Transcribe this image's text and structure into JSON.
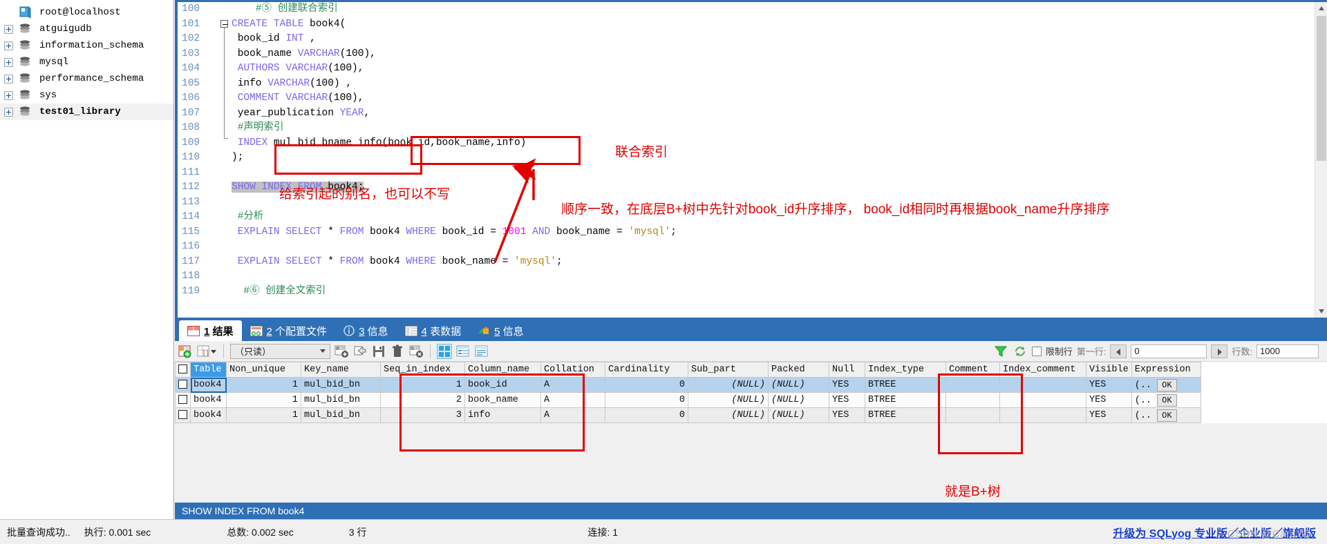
{
  "tree": {
    "root": {
      "label": "root@localhost",
      "icon": "server-icon"
    },
    "items": [
      {
        "label": "atguigudb",
        "icon": "database-icon"
      },
      {
        "label": "information_schema",
        "icon": "database-icon"
      },
      {
        "label": "mysql",
        "icon": "database-icon"
      },
      {
        "label": "performance_schema",
        "icon": "database-icon"
      },
      {
        "label": "sys",
        "icon": "database-icon"
      },
      {
        "label": "test01_library",
        "icon": "database-icon"
      }
    ]
  },
  "editor": {
    "first_line": 100,
    "lines": [
      {
        "n": "100",
        "segs": [
          {
            "t": "    #⑤ 创建联合索引",
            "c": "cmt"
          }
        ]
      },
      {
        "n": "101",
        "segs": [
          {
            "t": "CREATE TABLE ",
            "c": "kw"
          },
          {
            "t": "book4(",
            "c": ""
          }
        ]
      },
      {
        "n": "102",
        "segs": [
          {
            "t": " book_id ",
            "c": ""
          },
          {
            "t": "INT",
            "c": "kw"
          },
          {
            "t": " ,",
            "c": ""
          }
        ]
      },
      {
        "n": "103",
        "segs": [
          {
            "t": " book_name ",
            "c": ""
          },
          {
            "t": "VARCHAR",
            "c": "kw"
          },
          {
            "t": "(100),",
            "c": ""
          }
        ]
      },
      {
        "n": "104",
        "segs": [
          {
            "t": " ",
            "c": ""
          },
          {
            "t": "AUTHORS VARCHAR",
            "c": "kw"
          },
          {
            "t": "(100),",
            "c": ""
          }
        ]
      },
      {
        "n": "105",
        "segs": [
          {
            "t": " info ",
            "c": ""
          },
          {
            "t": "VARCHAR",
            "c": "kw"
          },
          {
            "t": "(100) ,",
            "c": ""
          }
        ]
      },
      {
        "n": "106",
        "segs": [
          {
            "t": " ",
            "c": ""
          },
          {
            "t": "COMMENT VARCHAR",
            "c": "kw"
          },
          {
            "t": "(100),",
            "c": ""
          }
        ]
      },
      {
        "n": "107",
        "segs": [
          {
            "t": " year_publication ",
            "c": ""
          },
          {
            "t": "YEAR",
            "c": "kw"
          },
          {
            "t": ",",
            "c": ""
          }
        ]
      },
      {
        "n": "108",
        "segs": [
          {
            "t": " #声明索引",
            "c": "cmt"
          }
        ]
      },
      {
        "n": "109",
        "segs": [
          {
            "t": " ",
            "c": ""
          },
          {
            "t": "INDEX",
            "c": "kw"
          },
          {
            "t": " mul_bid_bname_info(book_id,book_name,info)",
            "c": ""
          }
        ]
      },
      {
        "n": "110",
        "segs": [
          {
            "t": ");",
            "c": ""
          }
        ]
      },
      {
        "n": "111",
        "segs": [
          {
            "t": "",
            "c": ""
          }
        ]
      },
      {
        "n": "112",
        "segs": [
          {
            "t": "SHOW INDEX FROM ",
            "c": "kw sel"
          },
          {
            "t": "book4;",
            "c": "sel"
          }
        ]
      },
      {
        "n": "113",
        "segs": [
          {
            "t": "",
            "c": ""
          }
        ]
      },
      {
        "n": "114",
        "segs": [
          {
            "t": " #分析",
            "c": "cmt"
          }
        ]
      },
      {
        "n": "115",
        "segs": [
          {
            "t": " EXPLAIN SELECT ",
            "c": "kw"
          },
          {
            "t": "* ",
            "c": ""
          },
          {
            "t": "FROM ",
            "c": "kw"
          },
          {
            "t": "book4 ",
            "c": ""
          },
          {
            "t": "WHERE ",
            "c": "kw"
          },
          {
            "t": "book_id = ",
            "c": ""
          },
          {
            "t": "1001",
            "c": "num"
          },
          {
            "t": " ",
            "c": ""
          },
          {
            "t": "AND ",
            "c": "kw"
          },
          {
            "t": "book_name = ",
            "c": ""
          },
          {
            "t": "'mysql'",
            "c": "str"
          },
          {
            "t": ";",
            "c": ""
          }
        ]
      },
      {
        "n": "116",
        "segs": [
          {
            "t": "",
            "c": ""
          }
        ]
      },
      {
        "n": "117",
        "segs": [
          {
            "t": " EXPLAIN SELECT ",
            "c": "kw"
          },
          {
            "t": "* ",
            "c": ""
          },
          {
            "t": "FROM ",
            "c": "kw"
          },
          {
            "t": "book4 ",
            "c": ""
          },
          {
            "t": "WHERE ",
            "c": "kw"
          },
          {
            "t": "book_name = ",
            "c": ""
          },
          {
            "t": "'mysql'",
            "c": "str"
          },
          {
            "t": ";",
            "c": ""
          }
        ]
      },
      {
        "n": "118",
        "segs": [
          {
            "t": "",
            "c": ""
          }
        ]
      },
      {
        "n": "119",
        "segs": [
          {
            "t": "  #⑥ 创建全文索引",
            "c": "cmt"
          }
        ]
      }
    ]
  },
  "result_tabs": [
    {
      "num": "1",
      "label": "结果",
      "icon": "grid-icon",
      "active": true
    },
    {
      "num": "2",
      "label": "个配置文件",
      "icon": "profile-icon",
      "active": false
    },
    {
      "num": "3",
      "label": "信息",
      "icon": "info-icon",
      "active": false
    },
    {
      "num": "4",
      "label": "表数据",
      "icon": "table-icon",
      "active": false
    },
    {
      "num": "5",
      "label": "信息",
      "icon": "chart-icon",
      "active": false
    }
  ],
  "grid_toolbar": {
    "mode_select": "（只读）",
    "limit_checkbox_label": "限制行",
    "first_row_label": "第一行:",
    "first_row_value": "0",
    "row_count_label": "行数:",
    "row_count_value": "1000"
  },
  "grid": {
    "headers": [
      "Table",
      "Non_unique",
      "Key_name",
      "Seq_in_index",
      "Column_name",
      "Collation",
      "Cardinality",
      "Sub_part",
      "Packed",
      "Null",
      "Index_type",
      "Comment",
      "Index_comment",
      "Visible",
      "Expression"
    ],
    "rows": [
      {
        "Table": "book4",
        "Non_unique": "1",
        "Key_name": "mul_bid_bn",
        "Seq_in_index": "1",
        "Column_name": "book_id",
        "Collation": "A",
        "Cardinality": "0",
        "Sub_part": "(NULL)",
        "Packed": "(NULL)",
        "Null": "YES",
        "Index_type": "BTREE",
        "Comment": "",
        "Index_comment": "",
        "Visible": "YES",
        "Expression": "(..",
        "Expression_btn": "OK"
      },
      {
        "Table": "book4",
        "Non_unique": "1",
        "Key_name": "mul_bid_bn",
        "Seq_in_index": "2",
        "Column_name": "book_name",
        "Collation": "A",
        "Cardinality": "0",
        "Sub_part": "(NULL)",
        "Packed": "(NULL)",
        "Null": "YES",
        "Index_type": "BTREE",
        "Comment": "",
        "Index_comment": "",
        "Visible": "YES",
        "Expression": "(..",
        "Expression_btn": "OK"
      },
      {
        "Table": "book4",
        "Non_unique": "1",
        "Key_name": "mul_bid_bn",
        "Seq_in_index": "3",
        "Column_name": "info",
        "Collation": "A",
        "Cardinality": "0",
        "Sub_part": "(NULL)",
        "Packed": "(NULL)",
        "Null": "YES",
        "Index_type": "BTREE",
        "Comment": "",
        "Index_comment": "",
        "Visible": "YES",
        "Expression": "(..",
        "Expression_btn": "OK"
      }
    ]
  },
  "sql_status": "SHOW INDEX FROM book4",
  "statusbar": {
    "message": "批量查询成功..",
    "exec": "执行: 0.001 sec",
    "total": "总数: 0.002 sec",
    "rows": "3 行",
    "connection": "连接: 1",
    "upgrade": "升级为 SQLyog 专业版／企业版／旗舰版",
    "watermark": "CSDN @CaraYQ"
  },
  "annotations": {
    "union_index": "联合索引",
    "alias_note": "给索引起的别名，也可以不写",
    "order_note": "顺序一致，在底层B+树中先针对book_id升序排序， book_id相同时再根据book_name升序排序",
    "btree_note": "就是B+树"
  },
  "colors": {
    "accent": "#2f6fb5",
    "annotation": "#e10000",
    "selection": "#b6d3ee",
    "header_sel": "#3d9ae8"
  }
}
